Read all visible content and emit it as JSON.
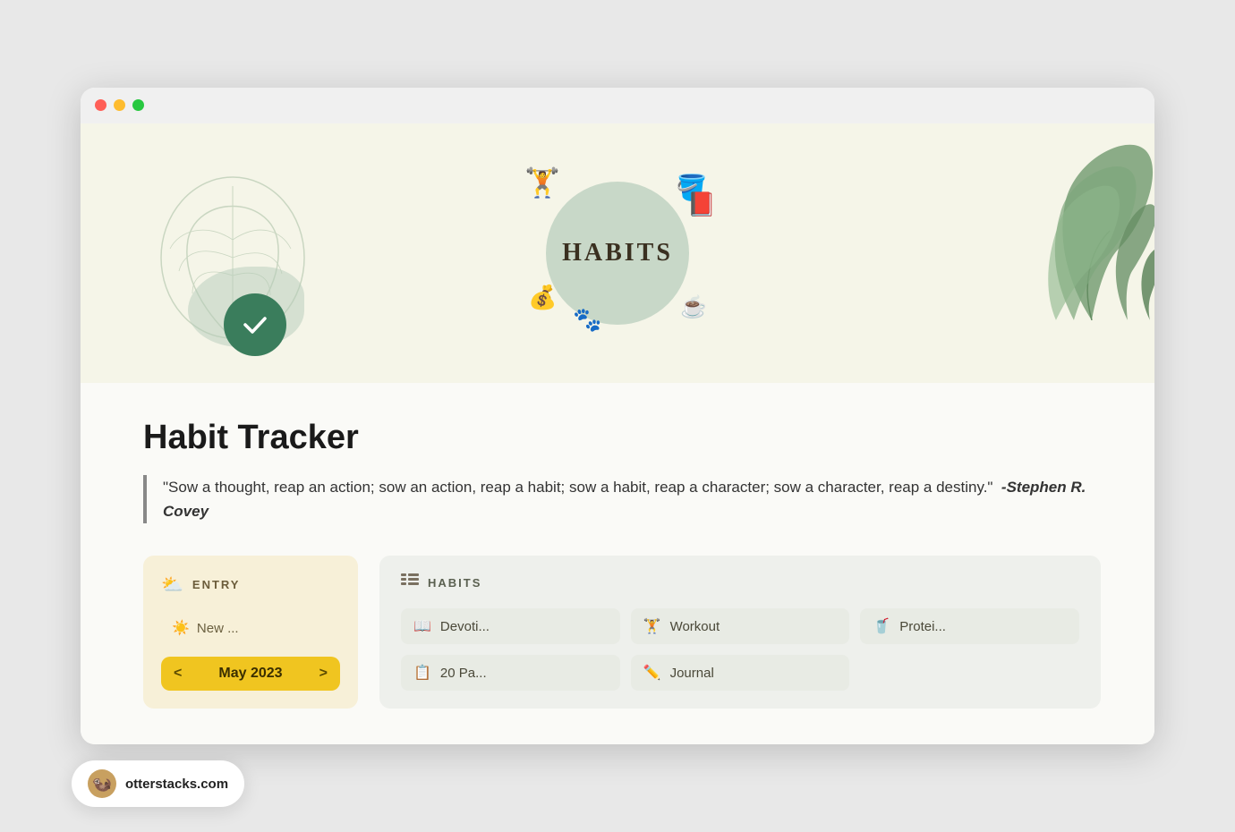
{
  "browser": {
    "traffic_lights": [
      "red",
      "yellow",
      "green"
    ]
  },
  "hero": {
    "title": "HABITS",
    "icons": {
      "dumbbell": "🏋️",
      "watering_can": "🪣",
      "book": "📕",
      "money": "💰",
      "paw": "🐾",
      "tea": "☕"
    }
  },
  "page": {
    "title": "Habit Tracker",
    "quote": {
      "text": "\"Sow a thought, reap an action; sow an action, reap a habit; sow a habit, reap a character; sow a character, reap a destiny.\"",
      "author": "-Stephen R. Covey"
    }
  },
  "entry_panel": {
    "header_icon": "⛅",
    "header_label": "ENTRY",
    "new_item": {
      "icon": "☀️",
      "label": "New ..."
    },
    "calendar": {
      "prev_arrow": "<",
      "next_arrow": ">",
      "month_year": "May 2023"
    }
  },
  "habits_panel": {
    "header_icon": "≔",
    "header_label": "HABITS",
    "items": [
      {
        "icon": "📖",
        "label": "Devoti..."
      },
      {
        "icon": "🏋",
        "label": "Workout"
      },
      {
        "icon": "🥤",
        "label": "Protei..."
      },
      {
        "icon": "📋",
        "label": "20 Pa..."
      },
      {
        "icon": "✏️",
        "label": "Journal"
      }
    ]
  },
  "footer": {
    "icon": "🦦",
    "url": "otterstacks.com"
  }
}
